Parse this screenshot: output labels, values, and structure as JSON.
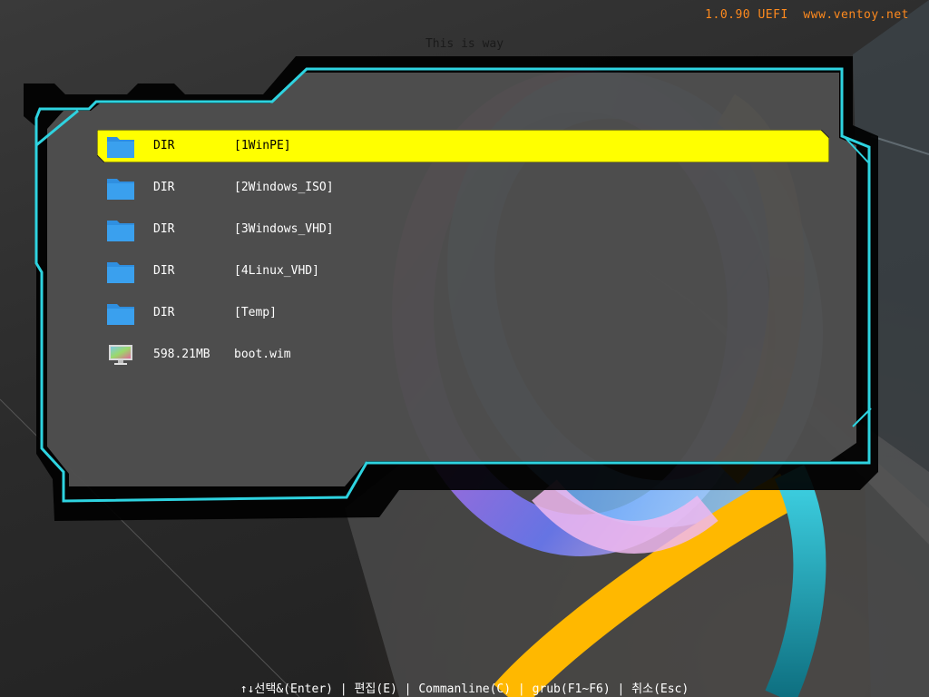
{
  "header": {
    "version": "1.0.90 UEFI",
    "website": "www.ventoy.net",
    "title": "This is way"
  },
  "colors": {
    "accent_cyan": "#2ed3e0",
    "selection": "#ffff00",
    "version_text": "#ff8a1e",
    "folder_icon": "#2f8fe0"
  },
  "menu": {
    "entries": [
      {
        "icon": "folder-icon",
        "size": "DIR",
        "name": "[1WinPE]",
        "selected": true
      },
      {
        "icon": "folder-icon",
        "size": "DIR",
        "name": "[2Windows_ISO]",
        "selected": false
      },
      {
        "icon": "folder-icon",
        "size": "DIR",
        "name": "[3Windows_VHD]",
        "selected": false
      },
      {
        "icon": "folder-icon",
        "size": "DIR",
        "name": "[4Linux_VHD]",
        "selected": false
      },
      {
        "icon": "folder-icon",
        "size": "DIR",
        "name": "[Temp]",
        "selected": false
      },
      {
        "icon": "monitor-image-icon",
        "size": "598.21MB",
        "name": "boot.wim",
        "selected": false
      }
    ]
  },
  "footer": {
    "select": "↑↓선택&(Enter)",
    "separator": " | ",
    "edit": "편집(E)",
    "cmdline": "Commanline(C)",
    "grub": "grub(F1~F6)",
    "cancel": "취소(Esc)"
  }
}
